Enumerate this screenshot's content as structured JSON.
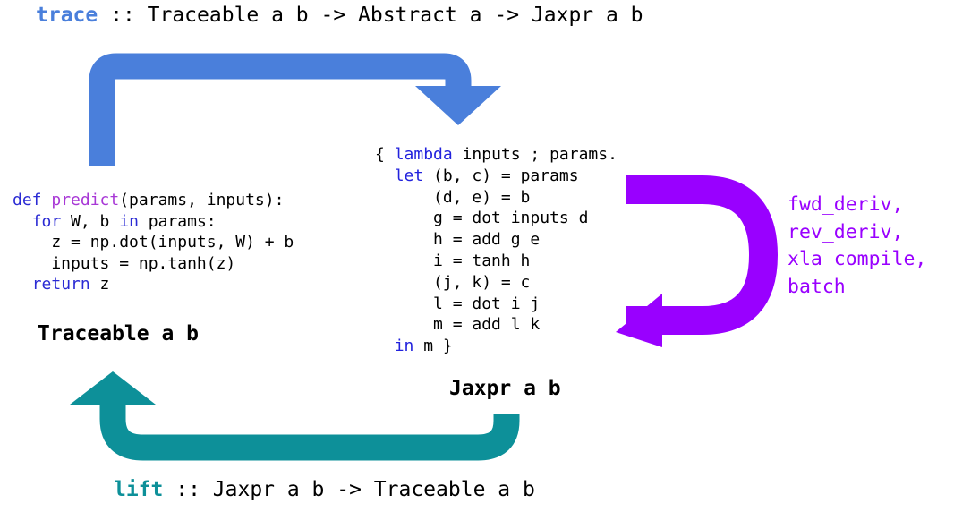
{
  "diagram": {
    "title_signature": {
      "keyword": "trace",
      "rest": " :: Traceable a b -> Abstract a -> Jaxpr a b",
      "keyword_color": "#4a7fdb"
    },
    "bottom_signature": {
      "keyword": "lift",
      "rest": " :: Jaxpr a b -> Traceable a b",
      "keyword_color": "#0d9099"
    },
    "python_code": {
      "lines": [
        [
          {
            "t": "def ",
            "c": "keyword"
          },
          {
            "t": "predict",
            "c": "function"
          },
          {
            "t": "(params, inputs):",
            "c": "plain"
          }
        ],
        [
          {
            "t": "  ",
            "c": "plain"
          },
          {
            "t": "for",
            "c": "keyword"
          },
          {
            "t": " W, b ",
            "c": "plain"
          },
          {
            "t": "in",
            "c": "keyword"
          },
          {
            "t": " params:",
            "c": "plain"
          }
        ],
        [
          {
            "t": "    z = np.dot(inputs, W) + b",
            "c": "plain"
          }
        ],
        [
          {
            "t": "    inputs = np.tanh(z)",
            "c": "plain"
          }
        ],
        [
          {
            "t": "  ",
            "c": "plain"
          },
          {
            "t": "return",
            "c": "keyword"
          },
          {
            "t": " z",
            "c": "plain"
          }
        ]
      ],
      "keyword_color": "#2b2bd4",
      "function_color": "#a838d6"
    },
    "jaxpr_code": {
      "lines": [
        [
          {
            "t": "{ ",
            "c": "plain"
          },
          {
            "t": "lambda",
            "c": "keyword"
          },
          {
            "t": " inputs ; params.",
            "c": "plain"
          }
        ],
        [
          {
            "t": "  ",
            "c": "plain"
          },
          {
            "t": "let",
            "c": "keyword"
          },
          {
            "t": " (b, c) = params",
            "c": "plain"
          }
        ],
        [
          {
            "t": "      (d, e) = b",
            "c": "plain"
          }
        ],
        [
          {
            "t": "      g = dot inputs d",
            "c": "plain"
          }
        ],
        [
          {
            "t": "      h = add g e",
            "c": "plain"
          }
        ],
        [
          {
            "t": "      i = tanh h",
            "c": "plain"
          }
        ],
        [
          {
            "t": "      (j, k) = c",
            "c": "plain"
          }
        ],
        [
          {
            "t": "      l = dot i j",
            "c": "plain"
          }
        ],
        [
          {
            "t": "      m = add l k",
            "c": "plain"
          }
        ],
        [
          {
            "t": "  ",
            "c": "plain"
          },
          {
            "t": "in",
            "c": "keyword"
          },
          {
            "t": " m }",
            "c": "plain"
          }
        ]
      ],
      "keyword_color": "#2222dd"
    },
    "labels": {
      "traceable": "Traceable a b",
      "jaxpr": "Jaxpr a b"
    },
    "transforms": {
      "items": [
        "fwd_deriv,",
        "rev_deriv,",
        "xla_compile,",
        "batch"
      ],
      "color": "#9900ff"
    },
    "arrows": {
      "trace_arrow": {
        "name": "trace-arrow",
        "color": "#4a7fdb",
        "direction": "left-up-right-down"
      },
      "transform_arrow": {
        "name": "transform-loop-arrow",
        "color": "#9900ff",
        "direction": "right-loop-back-left"
      },
      "lift_arrow": {
        "name": "lift-arrow",
        "color": "#0d9099",
        "direction": "right-down-left-up"
      }
    }
  }
}
